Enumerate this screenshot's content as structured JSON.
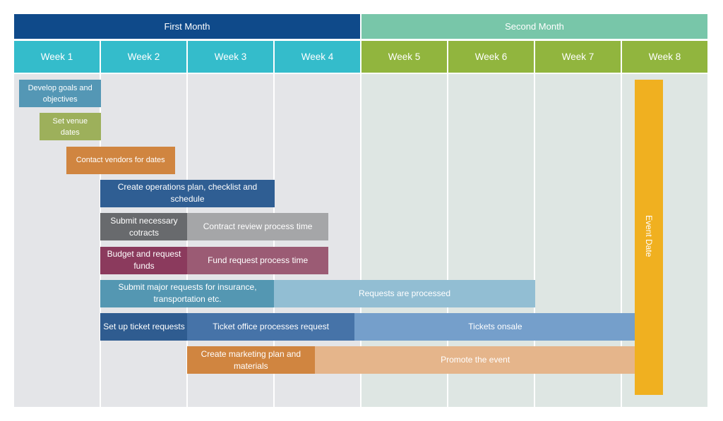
{
  "months": [
    {
      "label": "First Month",
      "color": "#0f4a8a"
    },
    {
      "label": "Second Month",
      "color": "#78c6a9"
    }
  ],
  "weeks": [
    {
      "label": "Week 1",
      "color": "#34bccb",
      "bg": "#e4e5e8"
    },
    {
      "label": "Week 2",
      "color": "#34bccb",
      "bg": "#e4e5e8"
    },
    {
      "label": "Week 3",
      "color": "#34bccb",
      "bg": "#e4e5e8"
    },
    {
      "label": "Week 4",
      "color": "#34bccb",
      "bg": "#e4e5e8"
    },
    {
      "label": "Week 5",
      "color": "#91b53e",
      "bg": "#dee6e3"
    },
    {
      "label": "Week 6",
      "color": "#91b53e",
      "bg": "#dee6e3"
    },
    {
      "label": "Week 7",
      "color": "#91b53e",
      "bg": "#dee6e3"
    },
    {
      "label": "Week 8",
      "color": "#91b53e",
      "bg": "#dee6e3"
    }
  ],
  "tasks": [
    {
      "row": 0,
      "segments": [
        {
          "label": "Develop goals and objectives",
          "start_week": 0.06,
          "end_week": 1.0,
          "color": "#5497b5",
          "small": true
        }
      ]
    },
    {
      "row": 1,
      "segments": [
        {
          "label": "Set venue dates",
          "start_week": 0.29,
          "end_week": 1.0,
          "color": "#9db05b",
          "small": true
        }
      ]
    },
    {
      "row": 2,
      "segments": [
        {
          "label": "Contact vendors for dates",
          "start_week": 0.6,
          "end_week": 1.85,
          "color": "#d08540",
          "small": true
        }
      ]
    },
    {
      "row": 3,
      "segments": [
        {
          "label": "Create operations plan, checklist and schedule",
          "start_week": 1.0,
          "end_week": 3.0,
          "color": "#2f5e93"
        }
      ]
    },
    {
      "row": 4,
      "segments": [
        {
          "label": "Submit necessary cotracts",
          "start_week": 1.0,
          "end_week": 2.0,
          "color": "#686a6d"
        },
        {
          "label": "Contract review process time",
          "start_week": 2.0,
          "end_week": 3.62,
          "color": "#a5a6a8"
        }
      ]
    },
    {
      "row": 5,
      "segments": [
        {
          "label": "Budget and request funds",
          "start_week": 1.0,
          "end_week": 2.0,
          "color": "#8b3a5d"
        },
        {
          "label": "Fund request process time",
          "start_week": 2.0,
          "end_week": 3.62,
          "color": "#9b5b74"
        }
      ]
    },
    {
      "row": 6,
      "segments": [
        {
          "label": "Submit major requests for insurance, transportation etc.",
          "start_week": 1.0,
          "end_week": 3.0,
          "color": "#5497b2"
        },
        {
          "label": "Requests are processed",
          "start_week": 3.0,
          "end_week": 6.0,
          "color": "#92bed3"
        }
      ]
    },
    {
      "row": 7,
      "segments": [
        {
          "label": "Set up ticket requests",
          "start_week": 1.0,
          "end_week": 2.0,
          "color": "#2f5c90"
        },
        {
          "label": "Ticket office processes request",
          "start_week": 2.0,
          "end_week": 3.92,
          "color": "#4673a8"
        },
        {
          "label": "Tickets onsale",
          "start_week": 3.92,
          "end_week": 7.16,
          "color": "#759fcb"
        }
      ]
    },
    {
      "row": 8,
      "segments": [
        {
          "label": "Create marketing plan and materials",
          "start_week": 2.0,
          "end_week": 3.46,
          "color": "#d08540"
        },
        {
          "label": "Promote the event",
          "start_week": 3.46,
          "end_week": 7.16,
          "color": "#e5b58b"
        }
      ]
    }
  ],
  "milestone": {
    "label": "Event Date",
    "start_week": 7.15,
    "end_week": 7.47,
    "color": "#f0b020"
  }
}
